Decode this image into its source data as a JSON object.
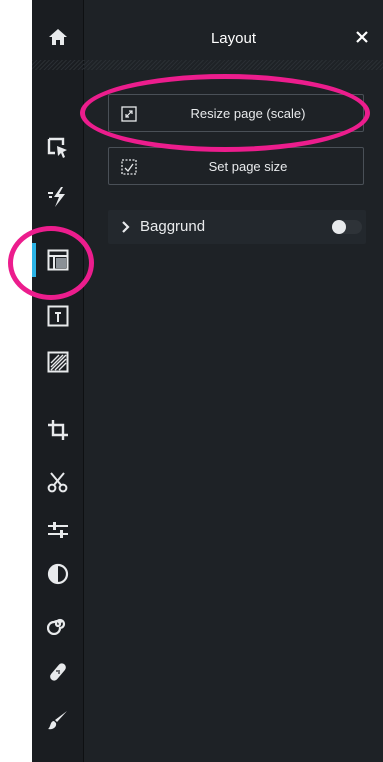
{
  "panel": {
    "title": "Layout",
    "close_glyph": "✕"
  },
  "buttons": {
    "resize_label": "Resize page (scale)",
    "set_size_label": "Set page size"
  },
  "section": {
    "label": "Baggrund",
    "toggle_on": false
  },
  "sidebar": {
    "active_item": "layout",
    "items": [
      "home-icon",
      "select-icon",
      "magic-icon",
      "layout-icon",
      "text-frame-icon",
      "texture-icon",
      "crop-icon",
      "cut-icon",
      "adjust-icon",
      "contrast-icon",
      "spiral-icon",
      "bandage-icon",
      "brush-icon"
    ]
  },
  "colors": {
    "accent": "#2bb3e6",
    "annotation": "#ec1d8d",
    "background": "#1e2226"
  }
}
